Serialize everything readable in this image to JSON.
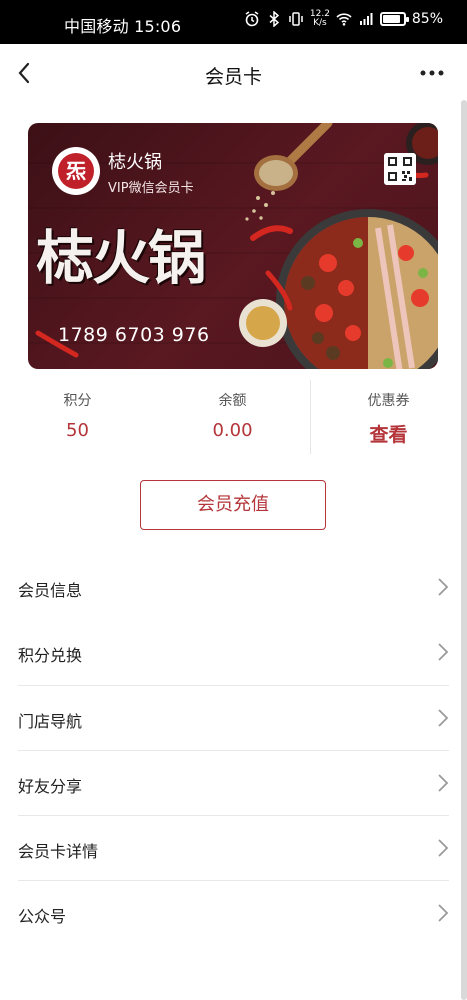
{
  "status_bar": {
    "carrier_time": "中国移动 15:06",
    "net_speed": "12.2\nK/s",
    "battery": "85%",
    "battery_level": 0.85
  },
  "nav": {
    "title": "会员卡"
  },
  "card": {
    "logo_char": "炁",
    "brand_name": "梽火锅",
    "subtitle": "VIP微信会员卡",
    "big_logo_text": "梽火锅",
    "card_number": "1789 6703 976"
  },
  "stats": [
    {
      "label": "积分",
      "value": "50"
    },
    {
      "label": "余额",
      "value": "0.00"
    },
    {
      "label": "优惠券",
      "value": "查看"
    }
  ],
  "recharge_label": "会员充值",
  "menu": [
    {
      "label": "会员信息"
    },
    {
      "label": "积分兑换"
    },
    {
      "label": "门店导航"
    },
    {
      "label": "好友分享"
    },
    {
      "label": "会员卡详情"
    },
    {
      "label": "公众号"
    }
  ],
  "colors": {
    "accent": "#b4353a",
    "card_bg": "#4a131b",
    "status_bar": "#000000"
  }
}
